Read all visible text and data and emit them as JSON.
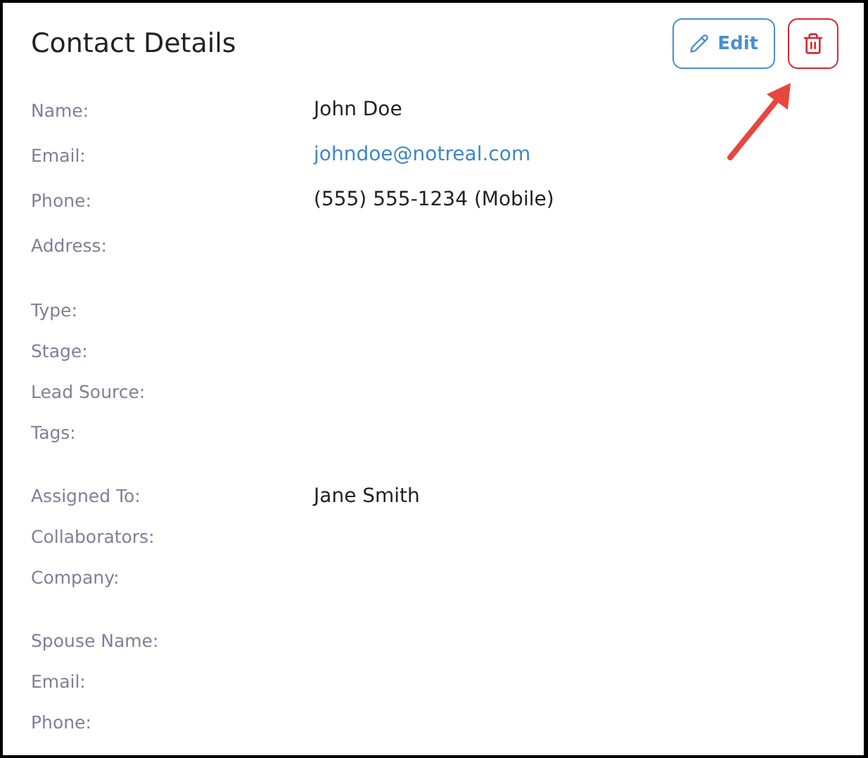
{
  "title": "Contact Details",
  "actions": [
    {
      "kind": "edit",
      "label": "Edit"
    },
    {
      "kind": "delete"
    }
  ],
  "sections": [
    {
      "rows": [
        {
          "label": "Name:",
          "value": "John Doe",
          "kind": "text"
        },
        {
          "label": "Email:",
          "value": "johndoe@notreal.com",
          "kind": "link"
        },
        {
          "label": "Phone:",
          "value": "(555) 555-1234 (Mobile)",
          "kind": "text"
        },
        {
          "label": "Address:"
        }
      ]
    },
    {
      "rows": [
        {
          "label": "Type:"
        },
        {
          "label": "Stage:"
        },
        {
          "label": "Lead Source:"
        },
        {
          "label": "Tags:"
        }
      ]
    },
    {
      "rows": [
        {
          "label": "Assigned To:",
          "value": "Jane Smith",
          "kind": "text"
        },
        {
          "label": "Collaborators:"
        },
        {
          "label": "Company:"
        }
      ]
    },
    {
      "rows": [
        {
          "label": "Spouse Name:"
        },
        {
          "label": "Email:"
        },
        {
          "label": "Phone:"
        }
      ]
    }
  ]
}
